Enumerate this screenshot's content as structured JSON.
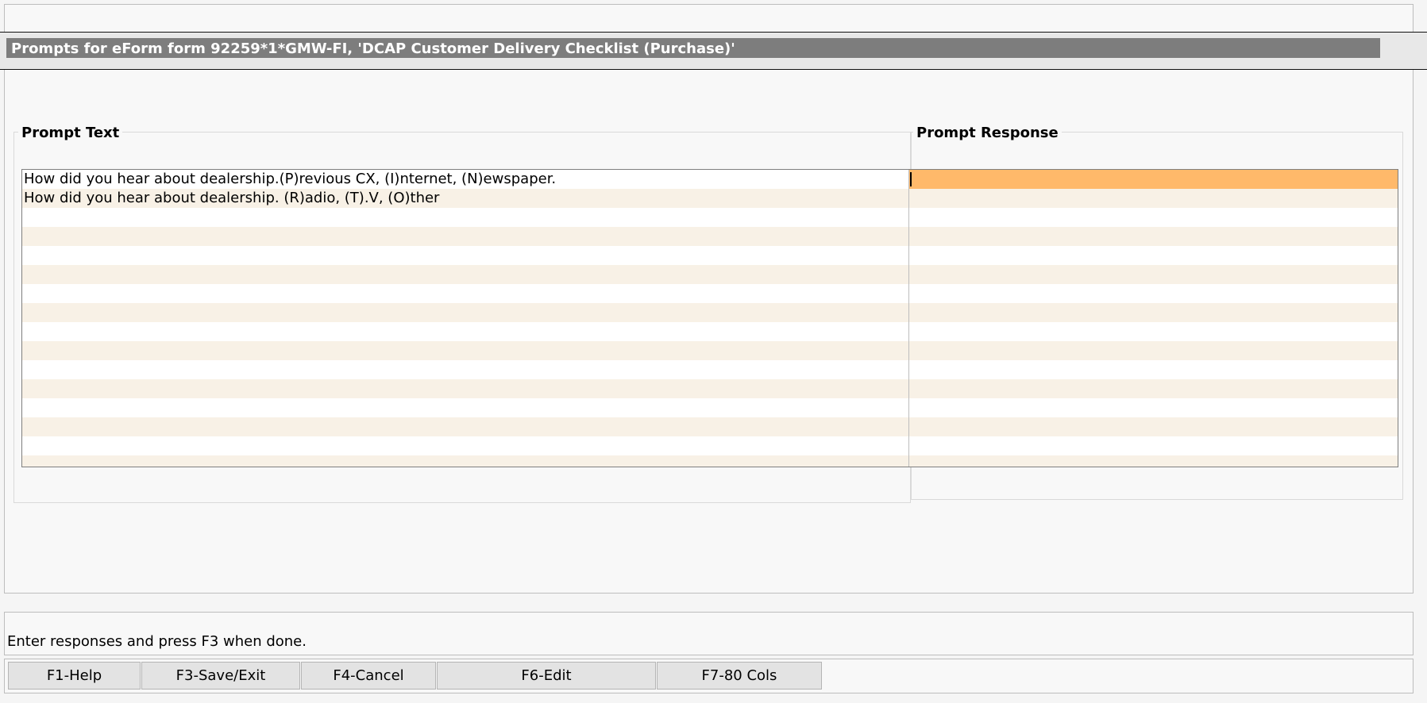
{
  "title": "Prompts for eForm form 92259*1*GMW-FI, 'DCAP Customer Delivery Checklist (Purchase)'",
  "columns": {
    "prompt_text": "Prompt Text",
    "prompt_response": "Prompt Response"
  },
  "rows": [
    {
      "prompt": "How did you hear about dealership.(P)revious CX, (I)nternet, (N)ewspaper.",
      "response": ""
    },
    {
      "prompt": "How did you hear about dealership. (R)adio, (T).V, (O)ther",
      "response": ""
    }
  ],
  "colors": {
    "active_response": "#ffb96a",
    "alt_row": "#f8f1e6",
    "title_strip": "#7d7d7d"
  },
  "status": {
    "message": "Enter responses and press F3 when done."
  },
  "fkeys": {
    "help": "F1-Help",
    "save_exit": "F3-Save/Exit",
    "cancel": "F4-Cancel",
    "edit": "F6-Edit",
    "cols80": "F7-80 Cols"
  }
}
